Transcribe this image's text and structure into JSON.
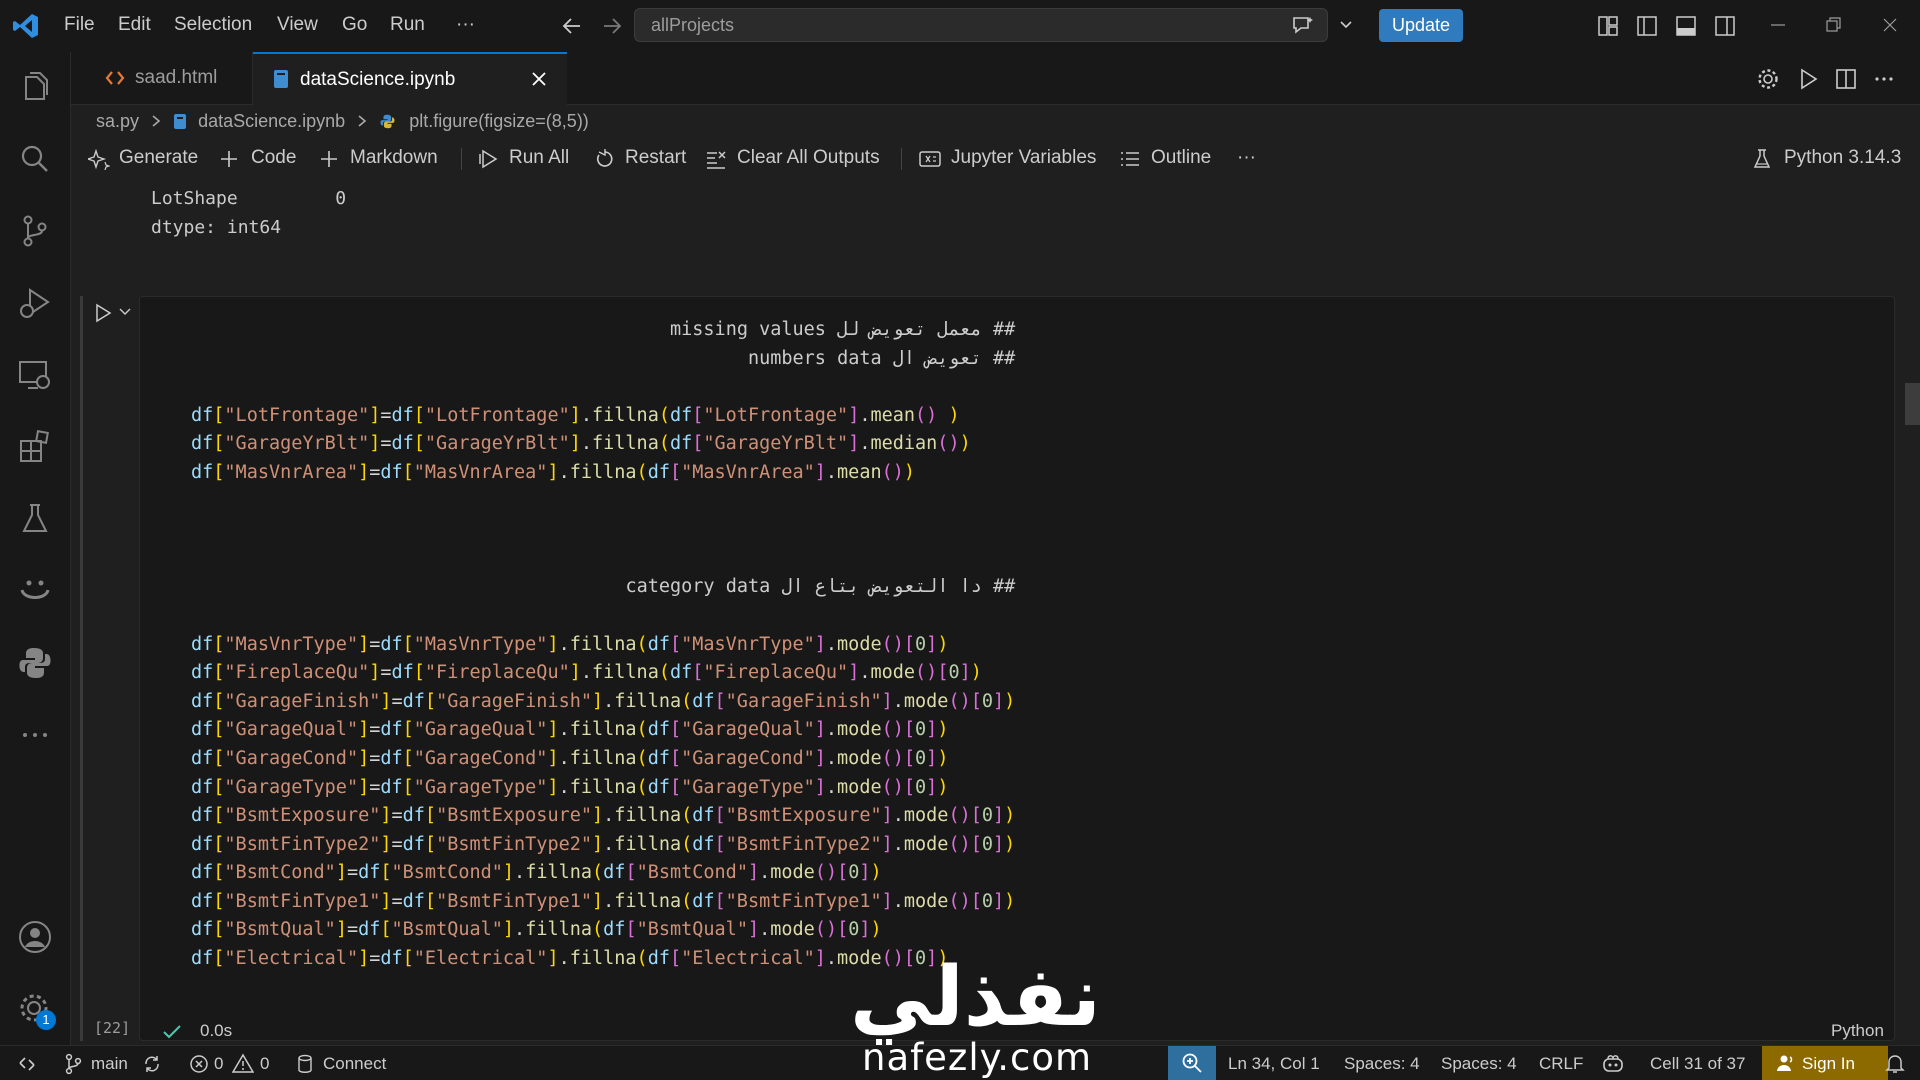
{
  "titlebar": {
    "menu": [
      "File",
      "Edit",
      "Selection",
      "View",
      "Go",
      "Run",
      "···"
    ],
    "search_text": "allProjects",
    "update_label": "Update"
  },
  "tabs": [
    {
      "label": "saad.html",
      "icon": "html-file-icon"
    },
    {
      "label": "dataScience.ipynb",
      "icon": "notebook-file-icon"
    }
  ],
  "breadcrumb": {
    "items": [
      "sa.py",
      "dataScience.ipynb",
      "plt.figure(figsize=(8,5))"
    ]
  },
  "toolbar": {
    "generate": "Generate",
    "code": "Code",
    "markdown": "Markdown",
    "run_all": "Run All",
    "restart": "Restart",
    "clear_outputs": "Clear All Outputs",
    "variables": "Jupyter Variables",
    "outline": "Outline",
    "more": "···",
    "kernel": "Python 3.14.3"
  },
  "output": {
    "lines": [
      "LotShape         0",
      "dtype: int64"
    ]
  },
  "cell": {
    "comment1": "## معمل تعويض لل missing values",
    "comment2": "## تعويض ال numbers data",
    "numeric_lines": [
      {
        "col": "LotFrontage",
        "fn": "mean",
        "extra": " "
      },
      {
        "col": "GarageYrBlt",
        "fn": "median",
        "extra": ""
      },
      {
        "col": "MasVnrArea",
        "fn": "mean",
        "extra": ""
      }
    ],
    "comment3": "## دا التعويض بتاع ال category data",
    "category_lines": [
      "MasVnrType",
      "FireplaceQu",
      "GarageFinish",
      "GarageQual",
      "GarageCond",
      "GarageType",
      "BsmtExposure",
      "BsmtFinType2",
      "BsmtCond",
      "BsmtFinType1",
      "BsmtQual",
      "Electrical"
    ],
    "exec_count": "[22]",
    "exec_time": "0.0s",
    "language": "Python"
  },
  "statusbar": {
    "branch": "main",
    "errors": "0",
    "warnings": "0",
    "connect": "Connect",
    "position": "Ln 34, Col 1",
    "spaces1": "Spaces: 4",
    "spaces2": "Spaces: 4",
    "eol": "CRLF",
    "cell_pos": "Cell 31 of 37",
    "sign_in": "Sign In"
  },
  "activity_badge": "1",
  "watermark": {
    "arabic": "نفذلي",
    "latin": "nafezly.com"
  },
  "colors": {
    "accent": "#0078d4",
    "update_button": "#2f7bbd",
    "signin_bg": "#8d6a00"
  }
}
